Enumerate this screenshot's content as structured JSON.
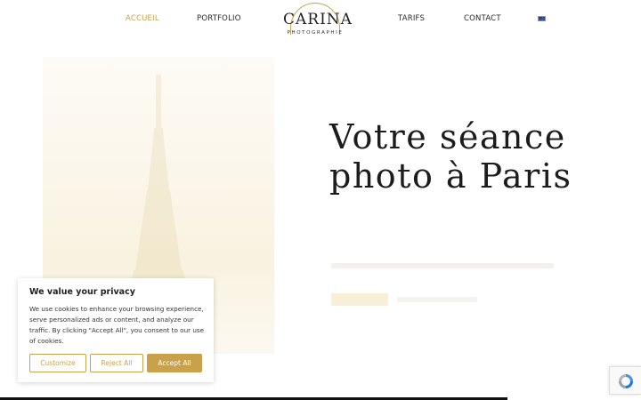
{
  "nav": {
    "items": [
      {
        "label": "ACCUEIL",
        "active": true
      },
      {
        "label": "PORTFOLIO",
        "active": false
      },
      {
        "label": "TARIFS",
        "active": false
      },
      {
        "label": "CONTACT",
        "active": false
      }
    ],
    "language_icon": "uk-flag-icon"
  },
  "logo": {
    "main": "CARINA",
    "sub": "PHOTOGRAPHIE"
  },
  "hero": {
    "headline_line1": "Votre séance",
    "headline_line2": "photo à Paris"
  },
  "cookie": {
    "title": "We value your privacy",
    "text": "We use cookies to enhance your browsing experience, serve personalized ads or content, and analyze our traffic. By clicking \"Accept All\", you consent to our use of cookies.",
    "customize_label": "Customize",
    "reject_label": "Reject All",
    "accept_label": "Accept All"
  },
  "colors": {
    "accent": "#c9a14a",
    "text": "#222222",
    "background": "#ffffff"
  },
  "recaptcha": {
    "icon": "recaptcha-icon"
  }
}
